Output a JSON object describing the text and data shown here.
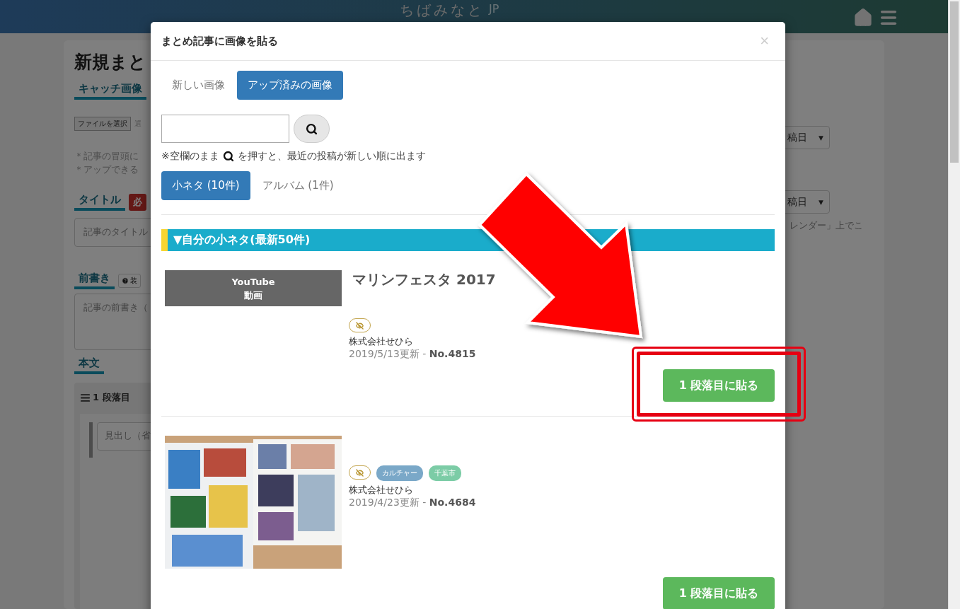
{
  "header": {
    "logo": "ちばみなと",
    "logo_suffix": "JP"
  },
  "page": {
    "title": "新規まと",
    "catch_label": "キャッチ画像",
    "file_button": "ファイルを選択",
    "file_note": "選",
    "notes": [
      "＊記事の冒頭に",
      "＊アップできる"
    ],
    "title_label": "タイトル",
    "required_badge": "必",
    "title_placeholder": "記事のタイトル",
    "intro_label": "前書き",
    "decor_button": "装",
    "intro_placeholder": "記事の前書き（",
    "body_label": "本文",
    "paragraph_label": "1 段落目",
    "heading_placeholder": "見出し（省",
    "right_selects": [
      "稿日",
      "稿日"
    ],
    "select_caret": "▼",
    "right_note": "レンダー」上でこ"
  },
  "modal": {
    "title": "まとめ記事に画像を貼る",
    "close": "×",
    "source_tabs": [
      {
        "label": "新しい画像",
        "selected": false
      },
      {
        "label": "アップ済みの画像",
        "selected": true
      }
    ],
    "hint_before": "※空欄のまま",
    "hint_after": "を押すと、最近の投稿が新しい順に出ます",
    "category_tabs": [
      {
        "label": "小ネタ (10件)",
        "selected": true
      },
      {
        "label": "アルバム (1件)",
        "selected": false
      }
    ],
    "section_heading": "▼自分の小ネタ(最新50件)",
    "items": [
      {
        "kind": "video",
        "thumb_lines": [
          "YouTube",
          "動画"
        ],
        "title": "マリンフェスタ 2017",
        "author": "株式会社せひら",
        "updated": "2019/5/13更新 - **No.4815**",
        "button": "1 段落目に貼る",
        "highlighted": true
      },
      {
        "tags": [
          {
            "label": "カルチャー",
            "color": "#7aa8c8"
          },
          {
            "label": "千葉市",
            "color": "#7ccca6"
          }
        ],
        "author": "株式会社せひら",
        "updated": "2019/4/23更新 - **No.4684**",
        "button": "1 段落目に貼る",
        "highlighted": false
      }
    ]
  }
}
